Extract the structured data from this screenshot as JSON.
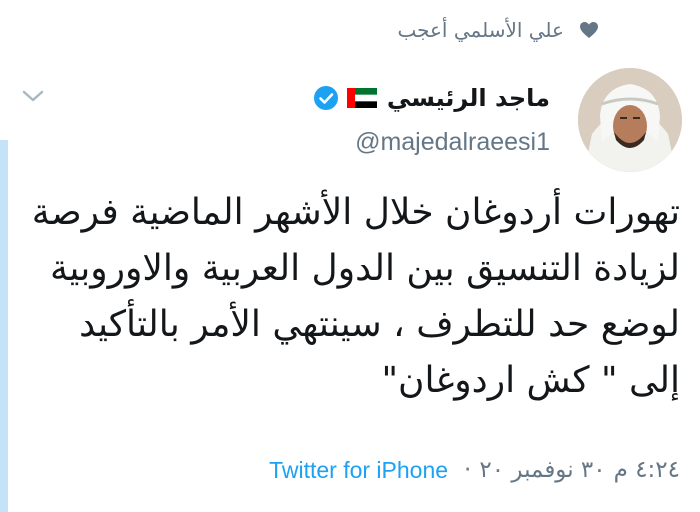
{
  "social_context": {
    "text": "علي الأسلمي أعجب",
    "icon": "heart-icon"
  },
  "author": {
    "display_name": "ماجد الرئيسي",
    "handle": "@majedalraeesi1",
    "verified": true,
    "flag": "uae-flag-icon"
  },
  "tweet": {
    "text": "تهورات أردوغان خلال الأشهر الماضية فرصة لزيادة التنسيق بين الدول العربية والاوروبية لوضع حد للتطرف ، سينتهي الأمر بالتأكيد إلى \" كش اردوغان\""
  },
  "meta": {
    "time": "٤:٢٤ م",
    "date": "٣٠ نوفمبر ٢٠",
    "separator": "·",
    "source": "Twitter for iPhone"
  },
  "colors": {
    "text_primary": "#14171a",
    "text_secondary": "#657786",
    "accent": "#1da1f2",
    "thread_line": "#c4e3f9"
  }
}
